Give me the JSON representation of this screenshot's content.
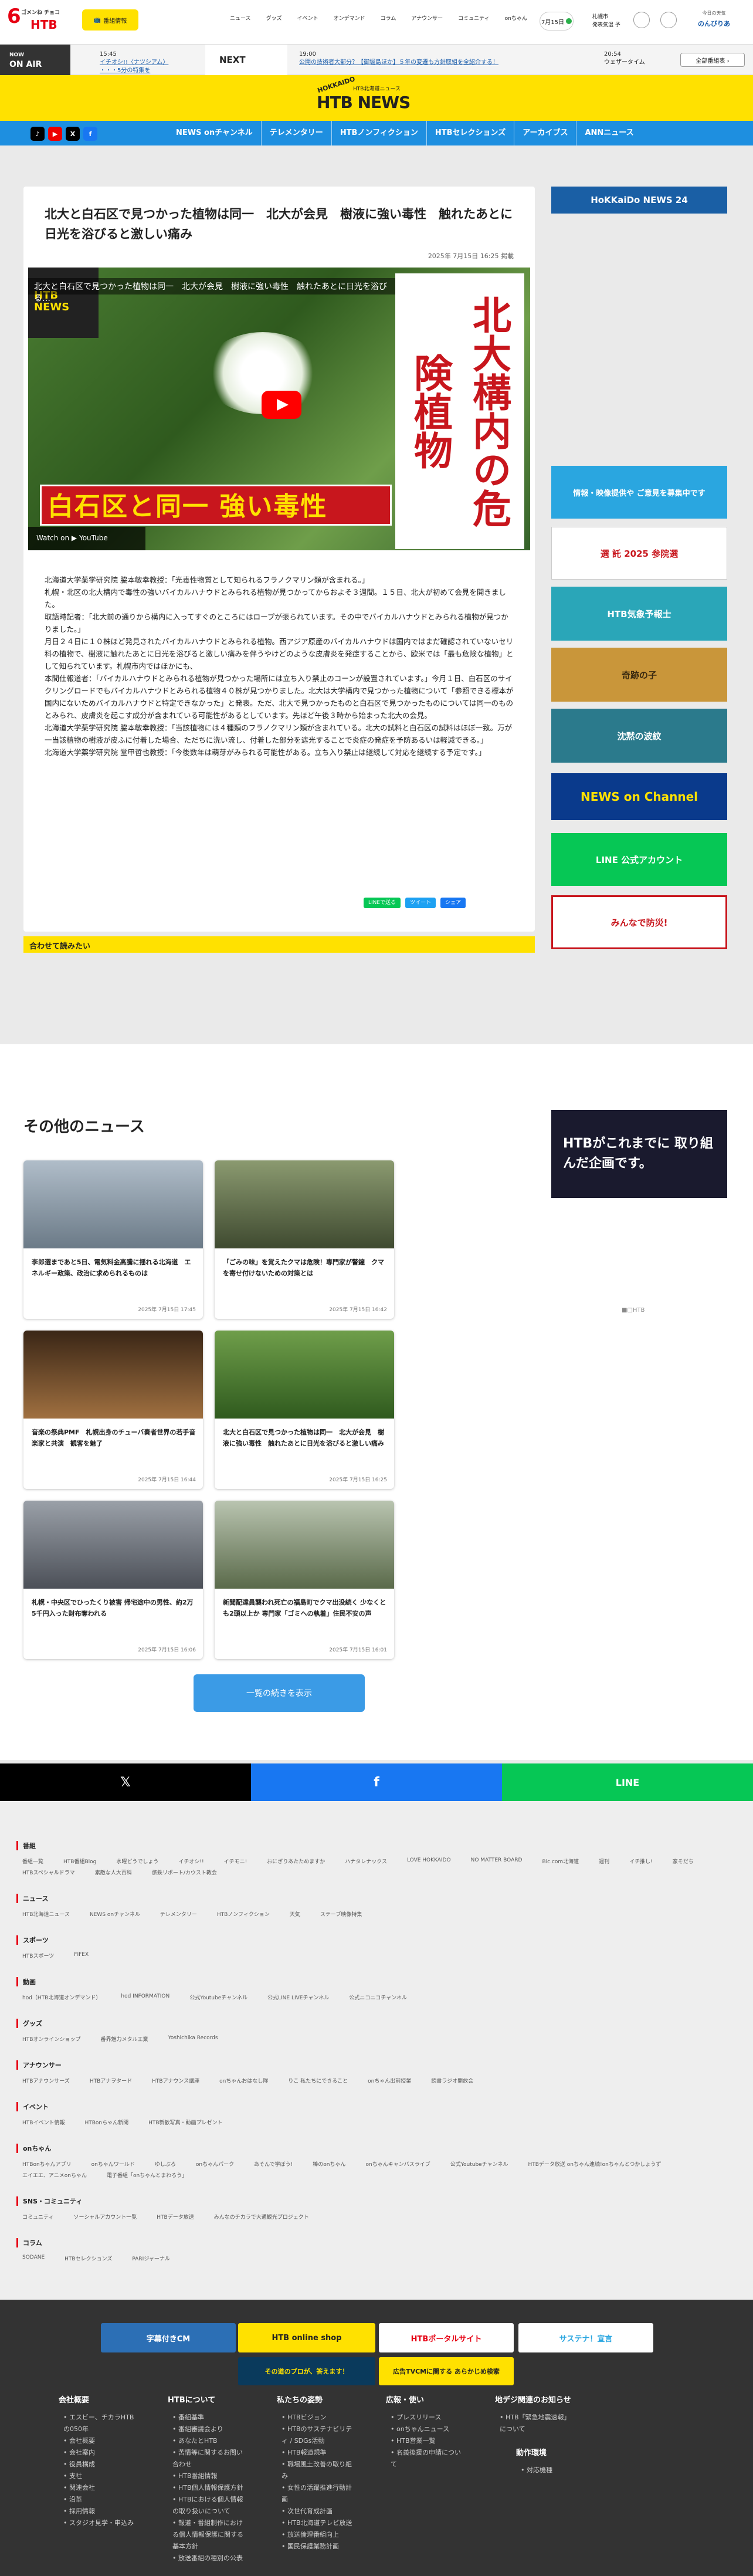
{
  "header": {
    "logo_six": "6",
    "logo_cha": "ゴメンね チョコ",
    "logo_htb": "HTB",
    "bangumi_label": "番組情報",
    "topnav": [
      "ニュース",
      "グッズ",
      "イベント",
      "オンデマンド",
      "コラム",
      "アナウンサー",
      "コミュニティ",
      "onちゃん"
    ],
    "date": "7月15日",
    "weather_city": "札幌市",
    "weather_sub": "発表気温 予 ",
    "region_label": "今日の天気",
    "region_value": "のんびりあ"
  },
  "onair": {
    "label": "NOW",
    "label2": "ON AIR",
    "now_time": "15:45",
    "now_title": "イチオシ!!〈ナツシアム〉",
    "now_sub": "・・・5分の特集を",
    "next_label": "NEXT",
    "next_time": "19:00",
    "next_title": "公開の技術者大部分？【御堀島ほか】５年の変遷も方針取組を全紹介する！",
    "next2_time": "20:54",
    "next2_title": "ウェザータイム",
    "tv_label": "全部番組表 ›"
  },
  "banner": {
    "hokkaido": "HOKKAIDO",
    "sub": "HTB北海道ニュース",
    "title": "HTB NEWS"
  },
  "mainnav": {
    "items": [
      "NEWS onチャンネル",
      "テレメンタリー",
      "HTBノンフィクション",
      "HTBセレクションズ",
      "アーカイブス",
      "ANNニュース"
    ]
  },
  "article": {
    "title": "北大と白石区で見つかった植物は同一　北大が会見　樹液に強い毒性　触れたあとに日光を浴びると激しい痛み",
    "date": "2025年 7月15日 16:25 掲載",
    "video_overlay": "北大と白石区で見つかった植物は同一　北大が会見　樹液に強い毒性　触れたあとに日光を浴びる…",
    "video_stamp": "HTB NEWS",
    "video_vertical": "北大構内の危険植物",
    "video_bottom": "白石区と同一 強い毒性",
    "watch": "Watch on ▶ YouTube",
    "paragraphs": [
      "北海道大学薬学研究院 脇本敏幸教授：「光毒性物質として知られるフラノクマリン類が含まれる。」",
      "札幌・北区の北大構内で毒性の強いバイカルハナウドとみられる植物が見つかってからおよそ３週間。１５日、北大が初めて会見を開きました。",
      "取語時記者：「北大前の通りから構内に入ってすぐのところにはロープが張られています。その中でバイカルハナウドとみられる植物が見つかりました。」",
      "月日２４日に１０株ほど発見されたバイカルハナウドとみられる植物。西アジア原産のバイカルハナウドは国内ではまだ確認されていないセリ科の植物で、樹液に触れたあとに日光を浴びると激しい痛みを伴うやけどのような皮膚炎を発症することから、欧米では「最も危険な植物」として知られています。札幌市内ではほかにも、",
      "本間仕報道者：「バイカルハナウドとみられる植物が見つかった場所には立ち入り禁止のコーンが設置されています。」今月１日、白石区のサイクリングロードでもバイカルハナウドとみられる植物４０株が見つかりました。北大は大学構内で見つかった植物について「参照できる標本が国内にないためバイカルハナウドと特定できなかった」と発表。ただ、北大で見つかったものと白石区で見つかったものについては同一のものとみられ、皮膚炎を起こす成分が含まれている可能性があるとしています。先ほど午後３時から始まった北大の会見。",
      "北海道大学薬学研究院 脇本敏幸教授：「当該植物には４種類のフラノクマリン類が含まれている。北大の試料と白石区の試料はほぼ一致。万が一当該植物の樹液が皮ふに付着した場合、ただちに洗い流し、付着した部分を遮光することで炎症の発症を予防あるいは軽減できる。」",
      "北海道大学薬学研究院 堂甲哲也教授：「今後数年は萌芽がみられる可能性がある。立ち入り禁止は継続して対応を継続する予定です。」"
    ],
    "share": [
      "LINEで送る",
      "ツイート",
      "シェア"
    ],
    "yomi_label": "合わせて読みたい"
  },
  "right": {
    "news24": "HoKKaiDo NEWS 24",
    "info": "情報・映像提供や ご意見を募集中です",
    "senkyo": "選 託 2025 参院選",
    "weather": "HTB気象予報士",
    "kiseki": "奇跡の子",
    "chinmoku": "沈黙の波紋",
    "newson": "NEWS on Channel",
    "line": "LINE 公式アカウント",
    "bosai": "みんなで防災!",
    "htb_ad": "HTBがこれまでに 取り組んだ企画です。",
    "ad_caption": "■□HTB"
  },
  "other": {
    "title": "その他のニュース",
    "cards": [
      {
        "title": "李郎選まであと5日、電気料金高騰に揺れる北海道　エネルギー政策、政治に求められるものは",
        "date": "2025年 7月15日 17:45",
        "color": "#8a97a5"
      },
      {
        "title": "「ごみの味」を覚えたクマは危険！専門家が警鐘　クマを寄せ付けないための対策とは",
        "date": "2025年 7月15日 16:42",
        "color": "#5c6a4a"
      },
      {
        "title": "音楽の祭典PMF　札幌出身のチューバ奏者世界の若手音楽家と共演　観客を魅了",
        "date": "2025年 7月15日 16:44",
        "color": "#6b4c2f"
      },
      {
        "title": "北大と白石区で見つかった植物は同一　北大が会見　樹液に強い毒性　触れたあとに日光を浴びると激しい痛み",
        "date": "2025年 7月15日 16:25",
        "color": "#4a7c32"
      },
      {
        "title": "札幌・中央区でひったくり被害 帰宅途中の男性、約2万5千円入った財布奪われる",
        "date": "2025年 7月15日 16:06",
        "color": "#7d7f85"
      },
      {
        "title": "新聞配達員襲われ死亡の福島町でクマ出没続く 少なくとも2頭以上か 専門家「ゴミへの執着」住民不安の声",
        "date": "2025年 7月15日 16:01",
        "color": "#7a8a6a"
      }
    ],
    "more_label": "一覧の続きを表示"
  },
  "sns": {
    "x": "𝕏",
    "fb": "f",
    "line": "LINE"
  },
  "sitemap": [
    {
      "title": "番組",
      "links": [
        "番組一覧",
        "HTB番組Blog",
        "水曜どうでしょう",
        "イチオシ!!",
        "イチモニ!",
        "おにぎりあたためますか",
        "ハナタレナックス",
        "LOVE HOKKAIDO",
        "NO MATTER BOARD",
        "Bic.com北海道",
        "週刊",
        "イチ推し!",
        "家そだち",
        "HTBスペシャルドラマ",
        "素敵な人大百科",
        "旅鉄リポート/カウスト教会"
      ]
    },
    {
      "title": "ニュース",
      "links": [
        "HTB北海道ニュース",
        "NEWS onチャンネル",
        "テレメンタリー",
        "HTBノンフィクション",
        "天気",
        "ステーブ映像特集"
      ]
    },
    {
      "title": "スポーツ",
      "links": [
        "HTBスポーツ",
        "FIFEX"
      ]
    },
    {
      "title": "動画",
      "links": [
        "hod（HTB北海道オンデマンド）",
        "hod INFORMATION",
        "公式Youtubeチャンネル",
        "公式LINE LIVEチャンネル",
        "公式ニコニコチャンネル"
      ]
    },
    {
      "title": "グッズ",
      "links": [
        "HTBオンラインショップ",
        "番界魅力メタル工業",
        "Yoshichika Records"
      ]
    },
    {
      "title": "アナウンサー",
      "links": [
        "HTBアナウンサーズ",
        "HTBアナヲタード",
        "HTBアナウンス講座",
        "onちゃんおはなし隊",
        "りこ 私たちにできること",
        "onちゃん出前授業",
        "読書ラジオ開放会"
      ]
    },
    {
      "title": "イベント",
      "links": [
        "HTBイベント情報",
        "HTBonちゃん新聞",
        "HTB新歓写真・動画プレゼント"
      ]
    },
    {
      "title": "onちゃん",
      "links": [
        "HTBonちゃんアプリ",
        "onちゃんワールド",
        "ゆしぶろ",
        "onちゃんパーク",
        "あそんで学ぼう!",
        "棒のonちゃん",
        "onちゃんキャンバスライブ",
        "公式Youtubeチャンネル",
        "HTBデータ放送 onちゃん連続!onちゃんとつかしょうず",
        "エイエエ、アニメonちゃん",
        "電子番組「onちゃんとまわろう」"
      ]
    },
    {
      "title": "SNS・コミュニティ",
      "links": [
        "コミュニティ",
        "ソーシャルアカウント一覧",
        "HTBデータ放送",
        "みんなのチカラで大通観光プロジェクト"
      ]
    },
    {
      "title": "コラム",
      "links": [
        "SODANE",
        "HTBセレクションズ",
        "PARIジャーナル"
      ]
    }
  ],
  "footer": {
    "banners": [
      "字幕付きCM",
      "HTB online shop",
      "HTBポータルサイト",
      "サステナ！宣言",
      "その道のプロが、答えます！",
      "広告TVCMに関する あらかじめ検索"
    ],
    "cols": [
      {
        "title": "会社概要",
        "links": [
          "エスビー、チカラHTBの050年",
          "会社概要",
          "会社案内",
          "役員構成",
          "支社",
          "関連会社",
          "沿革",
          "採用情報",
          "スタジオ見学・申込み"
        ]
      },
      {
        "title": "HTBについて",
        "links": [
          "番組基準",
          "番組審議会より",
          "あなたとHTB",
          "苦情等に関するお問い合わせ",
          "HTB番組情報",
          "HTB個人情報保護方針",
          "HTBにおける個人情報の取り扱いについて",
          "報道・番組制作における個人情報保護に関する基本方針",
          "放送番組の種別の公表"
        ]
      },
      {
        "title": "私たちの姿勢",
        "links": [
          "HTBビジョン",
          "HTBのサステナビリティ / SDGs活動",
          "HTB報道規準",
          "職場風土改善の取り組み",
          "女性の活躍推進行動計画",
          "次世代育成計画",
          "HTB北海道テレビ放送",
          "放送倫理番組向上",
          "国民保護業務計画"
        ]
      },
      {
        "title": "広報・使い",
        "links": [
          "プレスリリース",
          "onちゃんニュース",
          "HTB営業一覧",
          "名義後援の申請について"
        ]
      },
      {
        "title": "地デジ関連のお知らせ",
        "links": [
          "HTB「緊急地震速報」について"
        ]
      },
      {
        "title": "動作環境",
        "links": [
          "対応機種"
        ]
      }
    ]
  }
}
